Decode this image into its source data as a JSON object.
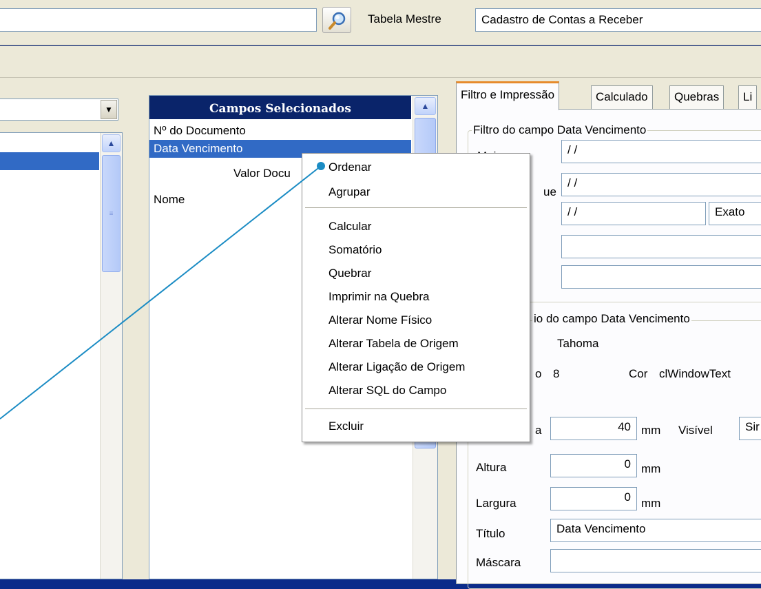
{
  "toolbar": {
    "search_value": "",
    "master_table_label": "Tabela Mestre",
    "master_table_value": "Cadastro de Contas a Receber"
  },
  "left_panel": {
    "combo_value": ""
  },
  "selected_fields": {
    "title": "Campos Selecionados",
    "items": [
      "Nº do Documento",
      "Data Vencimento",
      "Valor Docu",
      "Nome"
    ],
    "selected_index": 1
  },
  "context_menu": {
    "items": [
      "Ordenar",
      "Agrupar",
      "Calcular",
      "Somatório",
      "Quebrar",
      "Imprimir na Quebra",
      "Alterar Nome Físico",
      "Alterar Tabela de Origem",
      "Alterar Ligação de Origem",
      "Alterar SQL do Campo",
      "Excluir"
    ]
  },
  "tabs": [
    "Filtro e Impressão",
    "Calculado",
    "Quebras",
    "Li"
  ],
  "filter_group": {
    "title": "Filtro do campo Data Vencimento",
    "label_1": "Maior que",
    "value_1": "/ /",
    "label_2": "ue",
    "value_2": "/ /",
    "value_3": "/ /",
    "mode_value": "Exato",
    "value_4": "",
    "value_5": ""
  },
  "print_group": {
    "title": "io do campo Data Vencimento",
    "font_name": "Tahoma",
    "size_label": "o",
    "size_value": "8",
    "color_label": "Cor",
    "color_value": "clWindowText",
    "width_label_partial": "a",
    "width_value": "40",
    "width_unit": "mm",
    "visible_label": "Visível",
    "visible_value": "Sir",
    "height_label": "Altura",
    "height_value": "0",
    "height_unit": "mm",
    "largura_label": "Largura",
    "largura_value": "0",
    "largura_unit": "mm",
    "title_label": "Título",
    "title_value": "Data Vencimento",
    "mask_label": "Máscara",
    "mask_value": ""
  },
  "colors": {
    "desktop": "#0b2b8a",
    "selection": "#316ac5",
    "header": "#0a246a",
    "pointer_line": "#1b8cc4"
  }
}
